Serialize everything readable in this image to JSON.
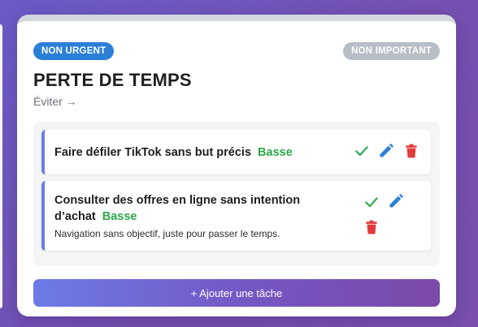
{
  "quadrant": {
    "urgency_badge": "NON URGENT",
    "importance_badge": "NON IMPORTANT",
    "title": "PERTE DE TEMPS",
    "subtitle": "Éviter →"
  },
  "tasks": [
    {
      "title": "Faire défiler TikTok sans but précis",
      "priority": "Basse",
      "description": ""
    },
    {
      "title": "Consulter des offres en ligne sans intention d’achat",
      "priority": "Basse",
      "description": "Navigation sans objectif, juste pour passer le temps."
    }
  ],
  "add_task_label": "+ Ajouter une tâche",
  "colors": {
    "urgency_badge": "#2b7fd6",
    "importance_badge": "#b7bec6",
    "priority_low": "#2ea84a",
    "check": "#2ea84a",
    "edit": "#2b7fd6",
    "delete": "#e03a3a",
    "task_accent": "#6a7fe0"
  },
  "icons": [
    "check-icon",
    "pencil-icon",
    "trash-icon"
  ]
}
